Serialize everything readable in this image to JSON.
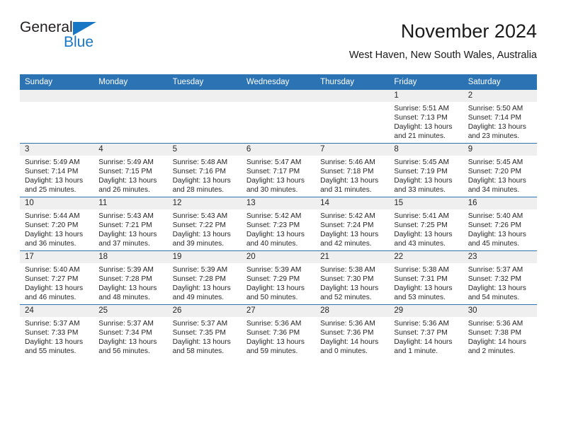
{
  "brand": {
    "name_line1": "General",
    "name_line2": "Blue",
    "accent_color": "#1877c4"
  },
  "header": {
    "title": "November 2024",
    "subtitle": "West Haven, New South Wales, Australia"
  },
  "calendar": {
    "header_color": "#2b73b3",
    "daynum_band_color": "#efefef",
    "weekday_headers": [
      "Sunday",
      "Monday",
      "Tuesday",
      "Wednesday",
      "Thursday",
      "Friday",
      "Saturday"
    ],
    "weeks": [
      [
        {
          "day": "",
          "sunrise": "",
          "sunset": "",
          "daylight_line1": "",
          "daylight_line2": ""
        },
        {
          "day": "",
          "sunrise": "",
          "sunset": "",
          "daylight_line1": "",
          "daylight_line2": ""
        },
        {
          "day": "",
          "sunrise": "",
          "sunset": "",
          "daylight_line1": "",
          "daylight_line2": ""
        },
        {
          "day": "",
          "sunrise": "",
          "sunset": "",
          "daylight_line1": "",
          "daylight_line2": ""
        },
        {
          "day": "",
          "sunrise": "",
          "sunset": "",
          "daylight_line1": "",
          "daylight_line2": ""
        },
        {
          "day": "1",
          "sunrise": "Sunrise: 5:51 AM",
          "sunset": "Sunset: 7:13 PM",
          "daylight_line1": "Daylight: 13 hours",
          "daylight_line2": "and 21 minutes."
        },
        {
          "day": "2",
          "sunrise": "Sunrise: 5:50 AM",
          "sunset": "Sunset: 7:14 PM",
          "daylight_line1": "Daylight: 13 hours",
          "daylight_line2": "and 23 minutes."
        }
      ],
      [
        {
          "day": "3",
          "sunrise": "Sunrise: 5:49 AM",
          "sunset": "Sunset: 7:14 PM",
          "daylight_line1": "Daylight: 13 hours",
          "daylight_line2": "and 25 minutes."
        },
        {
          "day": "4",
          "sunrise": "Sunrise: 5:49 AM",
          "sunset": "Sunset: 7:15 PM",
          "daylight_line1": "Daylight: 13 hours",
          "daylight_line2": "and 26 minutes."
        },
        {
          "day": "5",
          "sunrise": "Sunrise: 5:48 AM",
          "sunset": "Sunset: 7:16 PM",
          "daylight_line1": "Daylight: 13 hours",
          "daylight_line2": "and 28 minutes."
        },
        {
          "day": "6",
          "sunrise": "Sunrise: 5:47 AM",
          "sunset": "Sunset: 7:17 PM",
          "daylight_line1": "Daylight: 13 hours",
          "daylight_line2": "and 30 minutes."
        },
        {
          "day": "7",
          "sunrise": "Sunrise: 5:46 AM",
          "sunset": "Sunset: 7:18 PM",
          "daylight_line1": "Daylight: 13 hours",
          "daylight_line2": "and 31 minutes."
        },
        {
          "day": "8",
          "sunrise": "Sunrise: 5:45 AM",
          "sunset": "Sunset: 7:19 PM",
          "daylight_line1": "Daylight: 13 hours",
          "daylight_line2": "and 33 minutes."
        },
        {
          "day": "9",
          "sunrise": "Sunrise: 5:45 AM",
          "sunset": "Sunset: 7:20 PM",
          "daylight_line1": "Daylight: 13 hours",
          "daylight_line2": "and 34 minutes."
        }
      ],
      [
        {
          "day": "10",
          "sunrise": "Sunrise: 5:44 AM",
          "sunset": "Sunset: 7:20 PM",
          "daylight_line1": "Daylight: 13 hours",
          "daylight_line2": "and 36 minutes."
        },
        {
          "day": "11",
          "sunrise": "Sunrise: 5:43 AM",
          "sunset": "Sunset: 7:21 PM",
          "daylight_line1": "Daylight: 13 hours",
          "daylight_line2": "and 37 minutes."
        },
        {
          "day": "12",
          "sunrise": "Sunrise: 5:43 AM",
          "sunset": "Sunset: 7:22 PM",
          "daylight_line1": "Daylight: 13 hours",
          "daylight_line2": "and 39 minutes."
        },
        {
          "day": "13",
          "sunrise": "Sunrise: 5:42 AM",
          "sunset": "Sunset: 7:23 PM",
          "daylight_line1": "Daylight: 13 hours",
          "daylight_line2": "and 40 minutes."
        },
        {
          "day": "14",
          "sunrise": "Sunrise: 5:42 AM",
          "sunset": "Sunset: 7:24 PM",
          "daylight_line1": "Daylight: 13 hours",
          "daylight_line2": "and 42 minutes."
        },
        {
          "day": "15",
          "sunrise": "Sunrise: 5:41 AM",
          "sunset": "Sunset: 7:25 PM",
          "daylight_line1": "Daylight: 13 hours",
          "daylight_line2": "and 43 minutes."
        },
        {
          "day": "16",
          "sunrise": "Sunrise: 5:40 AM",
          "sunset": "Sunset: 7:26 PM",
          "daylight_line1": "Daylight: 13 hours",
          "daylight_line2": "and 45 minutes."
        }
      ],
      [
        {
          "day": "17",
          "sunrise": "Sunrise: 5:40 AM",
          "sunset": "Sunset: 7:27 PM",
          "daylight_line1": "Daylight: 13 hours",
          "daylight_line2": "and 46 minutes."
        },
        {
          "day": "18",
          "sunrise": "Sunrise: 5:39 AM",
          "sunset": "Sunset: 7:28 PM",
          "daylight_line1": "Daylight: 13 hours",
          "daylight_line2": "and 48 minutes."
        },
        {
          "day": "19",
          "sunrise": "Sunrise: 5:39 AM",
          "sunset": "Sunset: 7:28 PM",
          "daylight_line1": "Daylight: 13 hours",
          "daylight_line2": "and 49 minutes."
        },
        {
          "day": "20",
          "sunrise": "Sunrise: 5:39 AM",
          "sunset": "Sunset: 7:29 PM",
          "daylight_line1": "Daylight: 13 hours",
          "daylight_line2": "and 50 minutes."
        },
        {
          "day": "21",
          "sunrise": "Sunrise: 5:38 AM",
          "sunset": "Sunset: 7:30 PM",
          "daylight_line1": "Daylight: 13 hours",
          "daylight_line2": "and 52 minutes."
        },
        {
          "day": "22",
          "sunrise": "Sunrise: 5:38 AM",
          "sunset": "Sunset: 7:31 PM",
          "daylight_line1": "Daylight: 13 hours",
          "daylight_line2": "and 53 minutes."
        },
        {
          "day": "23",
          "sunrise": "Sunrise: 5:37 AM",
          "sunset": "Sunset: 7:32 PM",
          "daylight_line1": "Daylight: 13 hours",
          "daylight_line2": "and 54 minutes."
        }
      ],
      [
        {
          "day": "24",
          "sunrise": "Sunrise: 5:37 AM",
          "sunset": "Sunset: 7:33 PM",
          "daylight_line1": "Daylight: 13 hours",
          "daylight_line2": "and 55 minutes."
        },
        {
          "day": "25",
          "sunrise": "Sunrise: 5:37 AM",
          "sunset": "Sunset: 7:34 PM",
          "daylight_line1": "Daylight: 13 hours",
          "daylight_line2": "and 56 minutes."
        },
        {
          "day": "26",
          "sunrise": "Sunrise: 5:37 AM",
          "sunset": "Sunset: 7:35 PM",
          "daylight_line1": "Daylight: 13 hours",
          "daylight_line2": "and 58 minutes."
        },
        {
          "day": "27",
          "sunrise": "Sunrise: 5:36 AM",
          "sunset": "Sunset: 7:36 PM",
          "daylight_line1": "Daylight: 13 hours",
          "daylight_line2": "and 59 minutes."
        },
        {
          "day": "28",
          "sunrise": "Sunrise: 5:36 AM",
          "sunset": "Sunset: 7:36 PM",
          "daylight_line1": "Daylight: 14 hours",
          "daylight_line2": "and 0 minutes."
        },
        {
          "day": "29",
          "sunrise": "Sunrise: 5:36 AM",
          "sunset": "Sunset: 7:37 PM",
          "daylight_line1": "Daylight: 14 hours",
          "daylight_line2": "and 1 minute."
        },
        {
          "day": "30",
          "sunrise": "Sunrise: 5:36 AM",
          "sunset": "Sunset: 7:38 PM",
          "daylight_line1": "Daylight: 14 hours",
          "daylight_line2": "and 2 minutes."
        }
      ]
    ]
  }
}
